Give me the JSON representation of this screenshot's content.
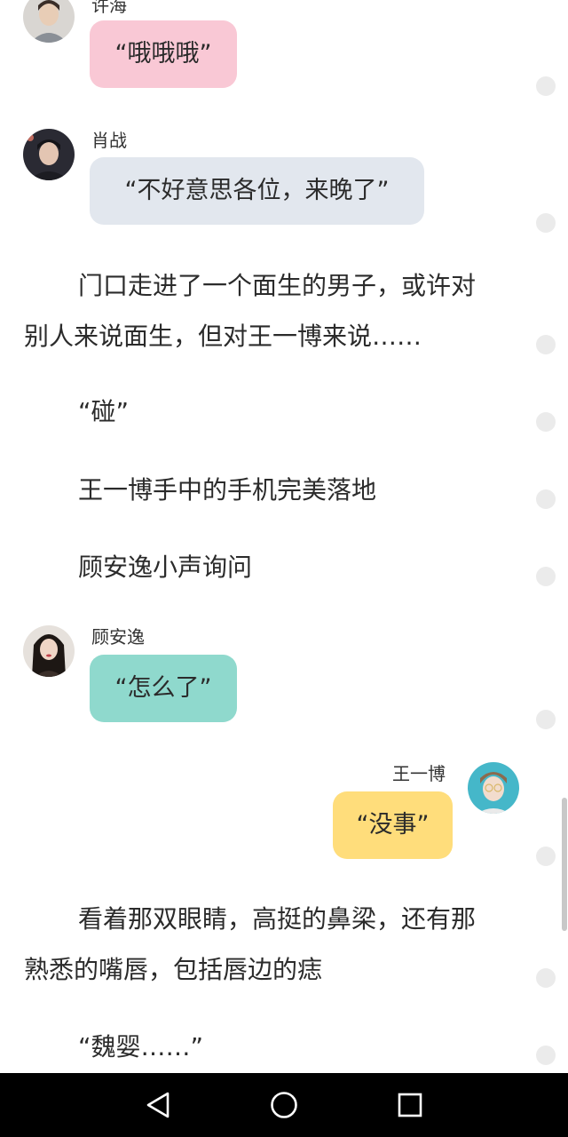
{
  "messages": [
    {
      "speaker": "许海",
      "text": "“哦哦哦”",
      "color": "#f9c8d5"
    },
    {
      "speaker": "肖战",
      "text": "“不好意思各位，来晚了”",
      "color": "#e2e7ee"
    },
    {
      "speaker": "顾安逸",
      "text": "“怎么了”",
      "color": "#8fd9cd"
    },
    {
      "speaker": "王一博",
      "text": "“没事”",
      "color": "#ffdd7b"
    }
  ],
  "narration": {
    "para1_line1": "门口走进了一个面生的男子，或许对",
    "para1_line2": "别人来说面生，但对王一博来说……",
    "line_peng": "“碰”",
    "line_phone": "王一博手中的手机完美落地",
    "line_ask": "顾安逸小声询问",
    "para2_line1": "看着那双眼睛，高挺的鼻梁，还有那",
    "para2_line2": "熟悉的嘴唇，包括唇边的痣",
    "line_weiying": "“魏婴……”"
  },
  "nav": {
    "back_icon": "back-triangle-icon",
    "home_icon": "home-circle-icon",
    "recent_icon": "recent-square-icon"
  }
}
